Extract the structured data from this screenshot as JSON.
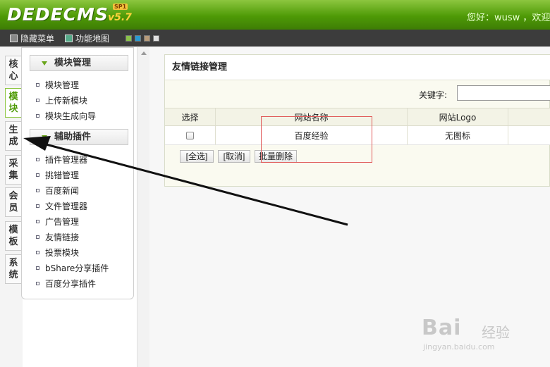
{
  "header": {
    "logo": "DEDECMS",
    "version": "v5.7",
    "sp_badge": "SP1",
    "greeting": "您好：wusw ，欢迎"
  },
  "toolbar": {
    "hide_menu": "隐藏菜单",
    "function_map": "功能地图",
    "swatches": [
      "#8bc34a",
      "#2a9ad0",
      "#b79b7a",
      "#e0e0e0"
    ]
  },
  "vtabs": [
    "核心",
    "模块",
    "生成",
    "采集",
    "会员",
    "模板",
    "系统"
  ],
  "menu": {
    "section1": {
      "title": "模块管理",
      "items": [
        "模块管理",
        "上传新模块",
        "模块生成向导"
      ]
    },
    "section2": {
      "title": "辅助插件",
      "items": [
        "插件管理器",
        "挑错管理",
        "百度新闻",
        "文件管理器",
        "广告管理",
        "友情链接",
        "投票模块",
        "bShare分享插件",
        "百度分享插件"
      ]
    }
  },
  "main": {
    "title": "友情链接管理",
    "keyword_label": "关键字:",
    "keyword_value": "",
    "table": {
      "headers": [
        "选择",
        "网站名称",
        "网站Logo",
        ""
      ],
      "rows": [
        {
          "name": "百度经验",
          "logo": "无图标"
        }
      ]
    },
    "buttons": {
      "select_all": "[全选]",
      "cancel": "[取消]",
      "batch_delete": "批量删除"
    }
  },
  "watermark": {
    "brand": "Bai",
    "brand2": "经验",
    "url": "jingyan.baidu.com"
  }
}
